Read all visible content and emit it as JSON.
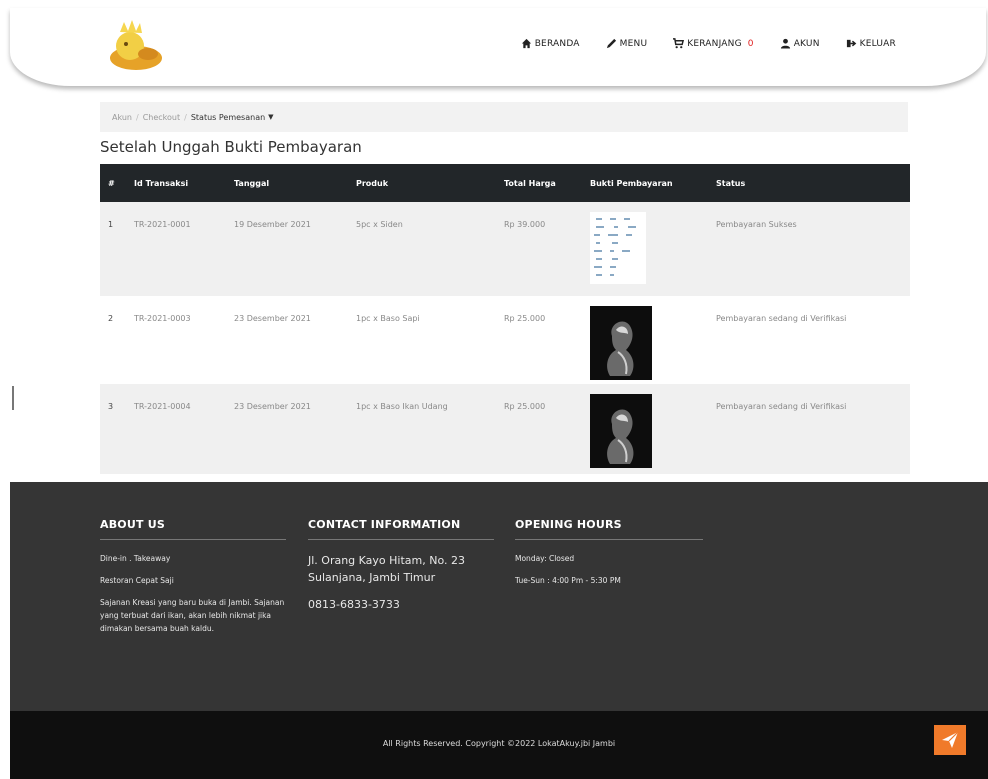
{
  "nav": {
    "items": [
      {
        "label": "BERANDA",
        "icon": "home-icon"
      },
      {
        "label": "MENU",
        "icon": "pencil-icon"
      },
      {
        "label": "KERANJANG",
        "icon": "cart-icon",
        "badge": "0"
      },
      {
        "label": "AKUN",
        "icon": "user-icon"
      },
      {
        "label": "KELUAR",
        "icon": "sign-out-icon"
      }
    ]
  },
  "breadcrumb": {
    "items": [
      "Akun",
      "Checkout"
    ],
    "current": "Status Pemesanan"
  },
  "page_title": "Setelah Unggah Bukti Pembayaran",
  "table": {
    "headers": [
      "#",
      "Id Transaksi",
      "Tanggal",
      "Produk",
      "Total Harga",
      "Bukti Pembayaran",
      "Status"
    ],
    "rows": [
      {
        "no": "1",
        "id": "TR-2021-0001",
        "date": "19 Desember 2021",
        "product": "5pc x Siden",
        "total": "Rp 39.000",
        "proof": "receipt",
        "status": "Pembayaran Sukses"
      },
      {
        "no": "2",
        "id": "TR-2021-0003",
        "date": "23 Desember 2021",
        "product": "1pc x Baso Sapi",
        "total": "Rp 25.000",
        "proof": "photo",
        "status": "Pembayaran sedang di Verifikasi"
      },
      {
        "no": "3",
        "id": "TR-2021-0004",
        "date": "23 Desember 2021",
        "product": "1pc x Baso Ikan Udang",
        "total": "Rp 25.000",
        "proof": "photo",
        "status": "Pembayaran sedang di Verifikasi"
      }
    ]
  },
  "footer": {
    "about": {
      "title": "ABOUT US",
      "lines": [
        "Dine-in . Takeaway",
        "Restoran Cepat Saji",
        "Sajanan Kreasi yang baru buka di Jambi. Sajanan yang terbuat dari ikan, akan lebih nikmat jika dimakan bersama buah kaldu."
      ]
    },
    "contact": {
      "title": "CONTACT INFORMATION",
      "address": "Jl. Orang Kayo Hitam, No. 23 Sulanjana, Jambi Timur",
      "phone": "0813-6833-3733"
    },
    "hours": {
      "title": "OPENING HOURS",
      "lines": [
        "Monday: Closed",
        "Tue-Sun : 4:00 Pm - 5:30 PM"
      ]
    }
  },
  "copyright": "All Rights Reserved. Copyright ©2022 LokatAkuy.jbi Jambi",
  "colors": {
    "header_dark": "#222629",
    "footer": "#353535",
    "footer_bottom": "#0f0f0f",
    "accent": "#f07a2a",
    "badge": "#e02020"
  }
}
